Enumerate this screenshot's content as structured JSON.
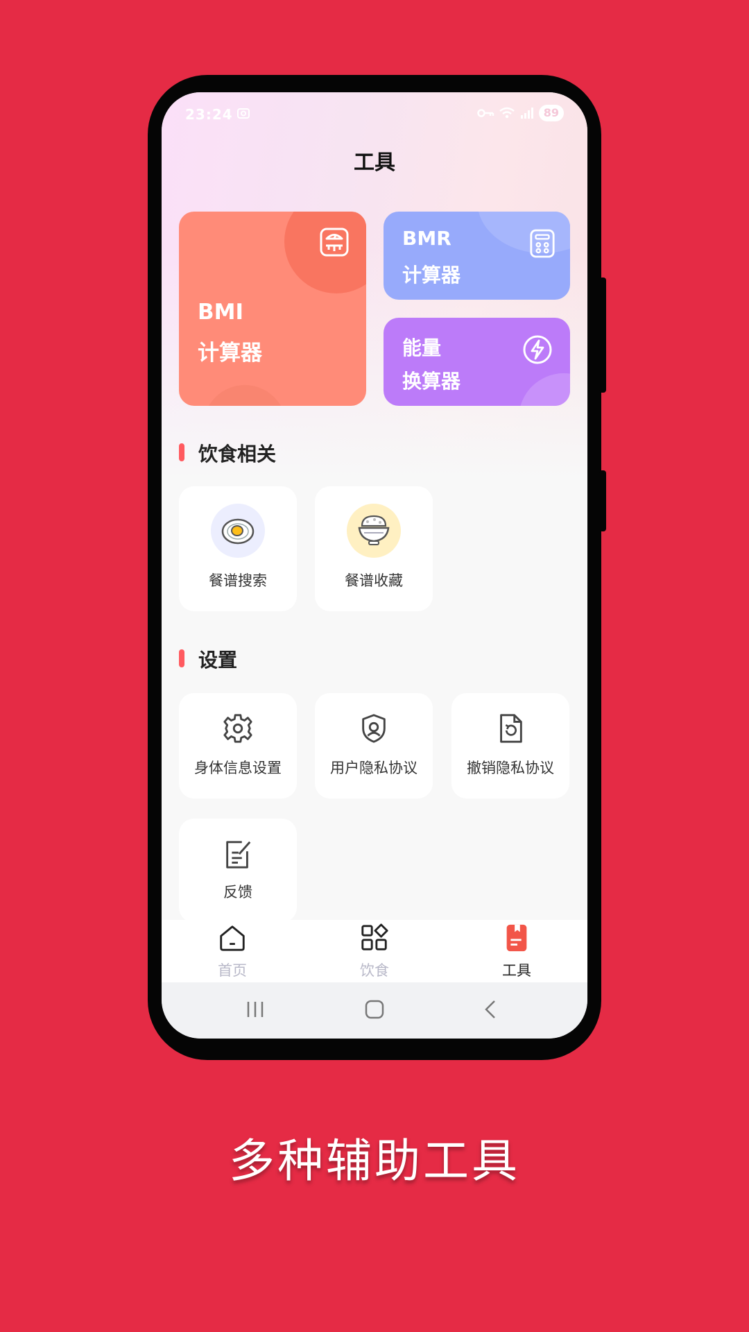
{
  "status_bar": {
    "time": "23:24",
    "battery": "89"
  },
  "header": {
    "title": "工具"
  },
  "cards": {
    "bmi": {
      "line1": "BMI",
      "line2": "计算器"
    },
    "bmr": {
      "line1": "BMR",
      "line2": "计算器"
    },
    "energy": {
      "line1": "能量",
      "line2": "换算器"
    }
  },
  "sections": {
    "diet": {
      "title": "饮食相关",
      "items": [
        {
          "label": "餐谱搜索",
          "icon": "fried-egg-icon"
        },
        {
          "label": "餐谱收藏",
          "icon": "rice-bowl-icon"
        }
      ]
    },
    "settings": {
      "title": "设置",
      "items": [
        {
          "label": "身体信息设置",
          "icon": "gear-icon"
        },
        {
          "label": "用户隐私协议",
          "icon": "shield-user-icon"
        },
        {
          "label": "撤销隐私协议",
          "icon": "document-revoke-icon"
        },
        {
          "label": "反馈",
          "icon": "edit-note-icon"
        }
      ]
    }
  },
  "tabbar": {
    "items": [
      {
        "label": "首页",
        "icon": "home-icon"
      },
      {
        "label": "饮食",
        "icon": "grid-apps-icon"
      },
      {
        "label": "工具",
        "icon": "tools-book-icon"
      }
    ],
    "active": "工具"
  },
  "colors": {
    "background": "#E52B45",
    "bmi_card": "#FF8B78",
    "bmr_card": "#97AAFB",
    "energy_card": "#BC7BF9",
    "accent": "#FF5A5F"
  },
  "caption": "多种辅助工具"
}
